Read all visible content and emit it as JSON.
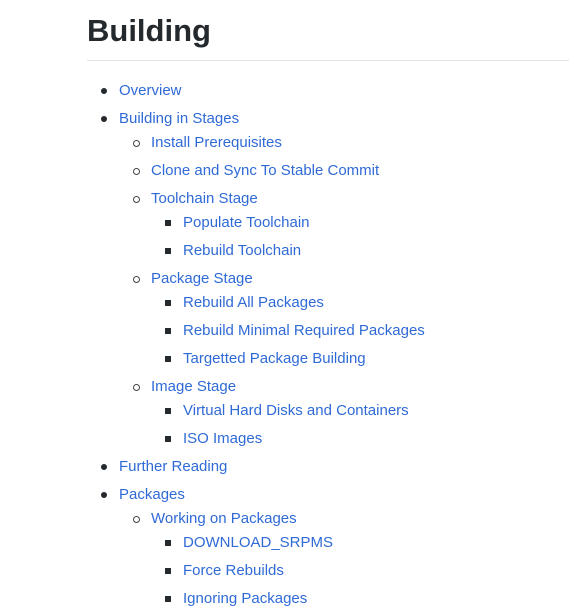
{
  "page_title": "Building",
  "colors": {
    "link": "#2f6ad6",
    "text": "#24292e",
    "rule": "#e1e4e8"
  },
  "toc": [
    {
      "label": "Overview"
    },
    {
      "label": "Building in Stages",
      "children": [
        {
          "label": "Install Prerequisites"
        },
        {
          "label": "Clone and Sync To Stable Commit"
        },
        {
          "label": "Toolchain Stage",
          "children": [
            {
              "label": "Populate Toolchain"
            },
            {
              "label": "Rebuild Toolchain"
            }
          ]
        },
        {
          "label": "Package Stage",
          "children": [
            {
              "label": "Rebuild All Packages"
            },
            {
              "label": "Rebuild Minimal Required Packages"
            },
            {
              "label": "Targetted Package Building"
            }
          ]
        },
        {
          "label": "Image Stage",
          "children": [
            {
              "label": "Virtual Hard Disks and Containers"
            },
            {
              "label": "ISO Images"
            }
          ]
        }
      ]
    },
    {
      "label": "Further Reading"
    },
    {
      "label": "Packages",
      "children": [
        {
          "label": "Working on Packages",
          "children": [
            {
              "label": "DOWNLOAD_SRPMS"
            },
            {
              "label": "Force Rebuilds"
            },
            {
              "label": "Ignoring Packages"
            }
          ]
        }
      ]
    }
  ]
}
